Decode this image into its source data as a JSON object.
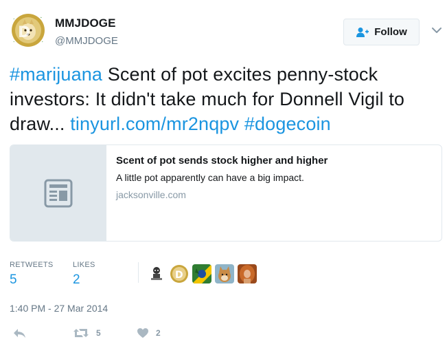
{
  "user": {
    "name": "MMJDOGE",
    "handle": "@MMJDOGE",
    "avatar_icon": "doge-coin-icon"
  },
  "follow": {
    "label": "Follow",
    "icon": "add-user-icon"
  },
  "menu": {
    "icon": "chevron-down-icon"
  },
  "text": {
    "hashtag1": "#marijuana",
    "body": " Scent of pot excites penny-stock investors: It didn't take much for Donnell Vigil to draw... ",
    "link": "tinyurl.com/mr2nqpv",
    "space": " ",
    "hashtag2": "#dogecoin"
  },
  "card": {
    "title": "Scent of pot sends stock higher and higher",
    "description": "A little pot apparently can have a big impact.",
    "domain": "jacksonville.com",
    "thumb_icon": "article-icon"
  },
  "stats": {
    "retweets_label": "RETWEETS",
    "retweets_value": "5",
    "likes_label": "LIKES",
    "likes_value": "2"
  },
  "likers": [
    {
      "icon": "liker-avatar-1"
    },
    {
      "icon": "liker-avatar-doge"
    },
    {
      "icon": "liker-avatar-leaf"
    },
    {
      "icon": "liker-avatar-shiba"
    },
    {
      "icon": "liker-avatar-person"
    }
  ],
  "timestamp": "1:40 PM - 27 Mar 2014",
  "actions": {
    "reply_icon": "reply-icon",
    "retweet_icon": "retweet-icon",
    "retweet_count": "5",
    "like_icon": "heart-icon",
    "like_count": "2"
  },
  "colors": {
    "link": "#1b95e0",
    "muted": "#657786",
    "border": "#e1e8ed",
    "text": "#14171a"
  }
}
